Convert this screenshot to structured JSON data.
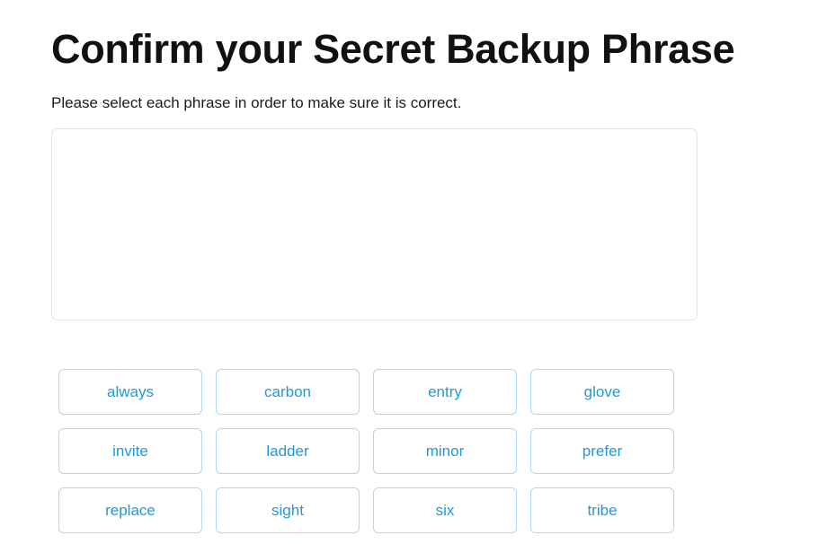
{
  "header": {
    "title": "Confirm your Secret Backup Phrase",
    "subtitle": "Please select each phrase in order to make sure it is correct."
  },
  "phrase_box": {
    "selected_words": [],
    "placeholder": ""
  },
  "word_grid": {
    "words": [
      {
        "label": "always"
      },
      {
        "label": "carbon"
      },
      {
        "label": "entry"
      },
      {
        "label": "glove"
      },
      {
        "label": "invite"
      },
      {
        "label": "ladder"
      },
      {
        "label": "minor"
      },
      {
        "label": "prefer"
      },
      {
        "label": "replace"
      },
      {
        "label": "sight"
      },
      {
        "label": "six"
      },
      {
        "label": "tribe"
      }
    ]
  },
  "colors": {
    "accent_blue": "#1f9ad6",
    "button_border": "#aed8ef",
    "box_border": "#e4e4e4",
    "text": "#111111",
    "background": "#ffffff"
  }
}
